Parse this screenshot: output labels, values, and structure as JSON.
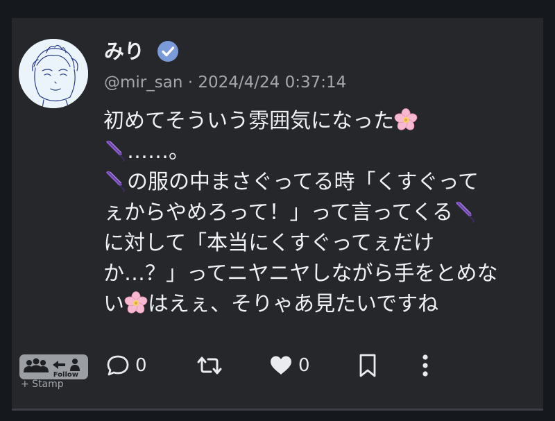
{
  "post": {
    "display_name": "みり",
    "meta": "@mir_san · 2024/4/24 0:37:14",
    "lines": [
      [
        "初めてそういう雰囲気になった",
        "cherry-blossom"
      ],
      [
        "umbrella",
        "……。"
      ],
      [
        "umbrella",
        "の服の中まさぐってる時「くすぐって"
      ],
      [
        "ぇからやめろって！」って言ってくる",
        "umbrella"
      ],
      [
        "に対して「本当にくすぐってぇだけ"
      ],
      [
        "か…？」ってニヤニヤしながら手をとめな"
      ],
      [
        "い",
        "cherry-blossom",
        "はえぇ、そりゃあ見たいですね"
      ]
    ]
  },
  "actions": {
    "reply_count": "0",
    "like_count": "0",
    "stamp_label": "+ Stamp",
    "follow_label": "Follow"
  },
  "icons": {
    "verified": "verified-badge-icon",
    "reply": "reply-bubble-icon",
    "repost": "repost-icon",
    "like": "heart-icon",
    "bookmark": "bookmark-icon",
    "more": "more-vertical-icon"
  },
  "colors": {
    "background": "#15181d",
    "card": "#25272b",
    "verified": "#7b9ad9",
    "secondary_text": "#a4a8ad"
  }
}
